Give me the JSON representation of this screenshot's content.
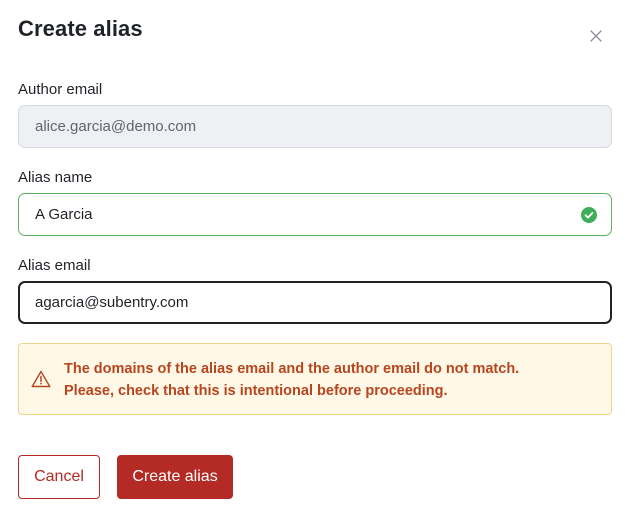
{
  "dialog": {
    "title": "Create alias",
    "close_icon": "close-icon"
  },
  "author_email": {
    "label": "Author email",
    "value": "alice.garcia@demo.com",
    "state": "disabled"
  },
  "alias_name": {
    "label": "Alias name",
    "value": "A Garcia",
    "state": "valid",
    "status_icon": "check-circle-icon"
  },
  "alias_email": {
    "label": "Alias email",
    "value": "agarcia@subentry.com",
    "state": "focused"
  },
  "warning": {
    "icon": "warning-triangle-icon",
    "line1": "The domains of the alias email and the author email do not match.",
    "line2": "Please, check that this is intentional before proceeding."
  },
  "actions": {
    "cancel_label": "Cancel",
    "submit_label": "Create alias"
  },
  "colors": {
    "primary": "#b42a24",
    "warning_text": "#b5461f",
    "warning_bg": "#fff8e6",
    "valid_border": "#5fb35f",
    "valid_icon": "#3fae5a"
  }
}
